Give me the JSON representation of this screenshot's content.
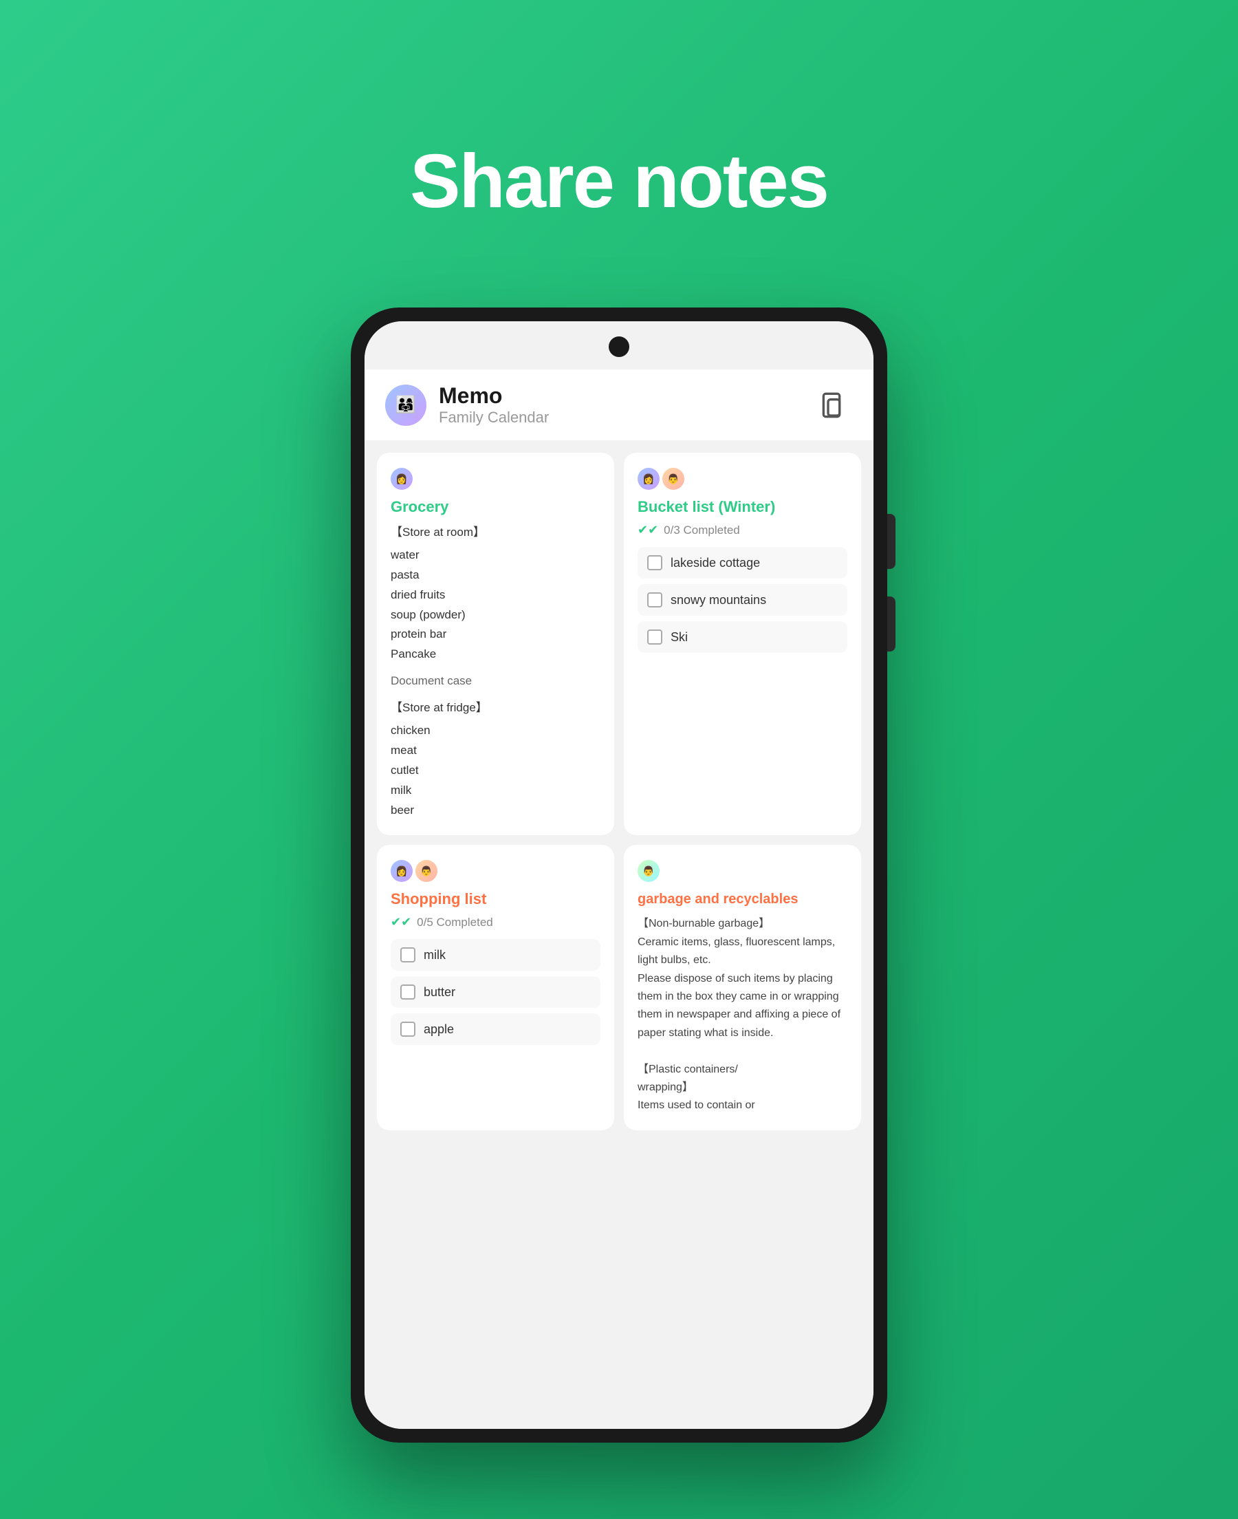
{
  "hero": {
    "title": "Share notes"
  },
  "app": {
    "name": "Memo",
    "subtitle": "Family Calendar"
  },
  "notes": [
    {
      "id": "grocery",
      "type": "text",
      "title": "Grocery",
      "title_color": "green",
      "avatars": [
        "a"
      ],
      "sections": [
        {
          "header": "【Store at room】",
          "items": [
            "water",
            "pasta",
            "dried fruits",
            "soup (powder)",
            "protein bar",
            "Pancake"
          ]
        },
        {
          "header": "Document case",
          "items": []
        },
        {
          "header": "【Store at fridge】",
          "items": [
            "chicken",
            "meat",
            "cutlet",
            "milk",
            "beer"
          ]
        }
      ]
    },
    {
      "id": "bucket-list",
      "type": "checklist",
      "title": "Bucket list (Winter)",
      "title_color": "green",
      "avatars": [
        "a",
        "b"
      ],
      "status": "0/3 Completed",
      "checklist_items": [
        "lakeside cottage",
        "snowy mountains",
        "Ski"
      ]
    },
    {
      "id": "shopping-list",
      "type": "checklist",
      "title": "Shopping list",
      "title_color": "orange",
      "avatars": [
        "a",
        "b"
      ],
      "status": "0/5 Completed",
      "checklist_items": [
        "milk",
        "butter",
        "apple"
      ]
    },
    {
      "id": "garbage",
      "type": "text",
      "title": "garbage and recyclables",
      "title_color": "orange",
      "avatars": [
        "c"
      ],
      "body": "【Non-burnable garbage】\nCeramic items, glass, fluorescent lamps, light bulbs, etc.\nPlease dispose of such items by placing them in the box they came in or wrapping them in newspaper and affixing a piece of paper stating what is inside.\n\n【Plastic containers/wrapping】\nItems used to contain or"
    }
  ],
  "icons": {
    "share": "⊞",
    "double_check": "✔✔",
    "camera": "●"
  }
}
